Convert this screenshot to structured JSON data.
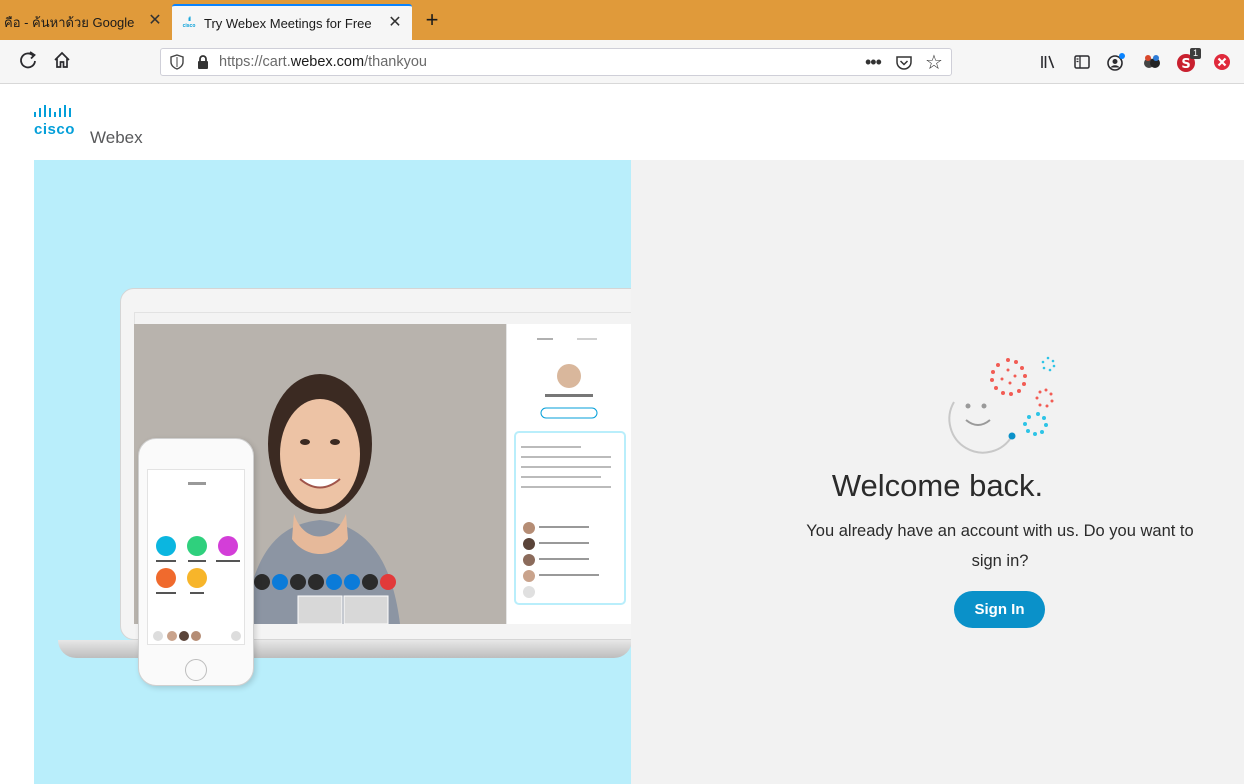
{
  "browser": {
    "tabs": [
      {
        "title": "คือ - ค้นหาด้วย Google",
        "active": false
      },
      {
        "title": "Try Webex Meetings for Free | ≡",
        "active": true
      }
    ],
    "close_glyph": "✕",
    "new_tab_glyph": "+",
    "url_prefix": "https://cart.",
    "url_domain": "webex.com",
    "url_path": "/thankyou",
    "page_actions_glyph": "•••",
    "bookmark_glyph": "☆",
    "reload_glyph": "↻",
    "home_glyph": "⌂",
    "extension_badge": "1"
  },
  "page": {
    "logo_bars": "·|ı·|ı·",
    "logo_cisco": "cisco",
    "logo_webex": "Webex",
    "welcome_title": "Welcome back.",
    "welcome_text": "You already have an account with us. Do you want to sign in?",
    "signin_label": "Sign In"
  },
  "colors": {
    "tabstrip": "#e09a3a",
    "left_panel_bg": "#b9eefb",
    "right_panel_bg": "#f2f2f2",
    "signin_button": "#0a91c9",
    "cisco_blue": "#049fd9"
  }
}
